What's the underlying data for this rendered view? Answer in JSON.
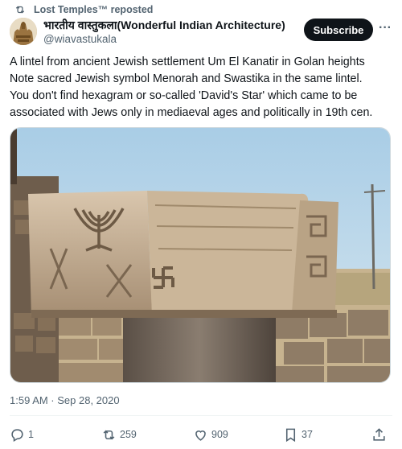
{
  "repost": {
    "label": "Lost Temples™ reposted",
    "icon": "repost-icon"
  },
  "author": {
    "display_name": "भारतीय वास्तुकला(Wonderful Indian Architecture)",
    "handle": "@wiavastukala",
    "avatar": "avatar-image"
  },
  "subscribe_label": "Subscribe",
  "more_icon": "more-horizontal-icon",
  "tweet": {
    "lines": [
      "A lintel from ancient Jewish settlement Um El Kanatir in Golan heights",
      "Note sacred Jewish symbol Menorah and Swastika in the same lintel.",
      "You don't find hexagram or so-called 'David's Star' which came to be",
      "associated with Jews only in mediaeval ages and politically in 19th cen."
    ]
  },
  "media": {
    "description_icon": "photo"
  },
  "timestamp": "1:59 AM · Sep 28, 2020",
  "actions": {
    "reply": {
      "count": "1",
      "icon": "reply-icon"
    },
    "repost": {
      "count": "259",
      "icon": "repost-icon"
    },
    "like": {
      "count": "909",
      "icon": "heart-icon"
    },
    "bookmark": {
      "count": "37",
      "icon": "bookmark-icon"
    },
    "share": {
      "icon": "share-icon"
    }
  },
  "colors": {
    "text": "#0f1419",
    "secondary": "#536471",
    "button_bg": "#0f1419",
    "border": "#cfd9de"
  }
}
